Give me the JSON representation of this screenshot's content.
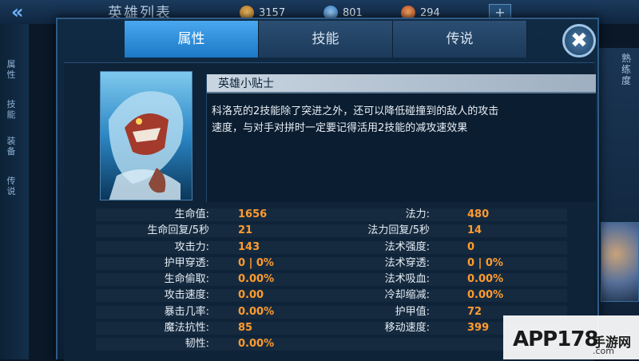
{
  "background": {
    "title": "英雄列表",
    "resources": [
      {
        "name": "gold-coin",
        "value": "3157"
      },
      {
        "name": "diamond",
        "value": "801"
      },
      {
        "name": "voucher",
        "value": "294"
      }
    ],
    "plus_label": "+",
    "rail_items": [
      "属性",
      "技能",
      "装备",
      "传说"
    ],
    "right_label": "熟练度"
  },
  "dialog": {
    "tabs": [
      {
        "label": "属性",
        "active": true
      },
      {
        "label": "技能",
        "active": false
      },
      {
        "label": "传说",
        "active": false
      }
    ],
    "close_label": "✖",
    "tips": {
      "title": "英雄小贴士",
      "line1": "科洛克的2技能除了突进之外，还可以降低碰撞到的敌人的攻击",
      "line2": "速度，与对手对拼时一定要记得活用2技能的减攻速效果"
    },
    "stats": [
      {
        "left_label": "生命值:",
        "left_value": "1656",
        "right_label": "法力:",
        "right_value": "480"
      },
      {
        "left_label": "生命回复/5秒",
        "left_value": "21",
        "right_label": "法力回复/5秒",
        "right_value": "14"
      },
      {
        "left_label": "攻击力:",
        "left_value": "143",
        "right_label": "法术强度:",
        "right_value": "0"
      },
      {
        "left_label": "护甲穿透:",
        "left_value": "0 | 0%",
        "right_label": "法术穿透:",
        "right_value": "0 | 0%"
      },
      {
        "left_label": "生命偷取:",
        "left_value": "0.00%",
        "right_label": "法术吸血:",
        "right_value": "0.00%"
      },
      {
        "left_label": "攻击速度:",
        "left_value": "0.00",
        "right_label": "冷却缩减:",
        "right_value": "0.00%"
      },
      {
        "left_label": "暴击几率:",
        "left_value": "0.00%",
        "right_label": "护甲值:",
        "right_value": "72"
      },
      {
        "left_label": "魔法抗性:",
        "left_value": "85",
        "right_label": "移动速度:",
        "right_value": "399"
      },
      {
        "left_label": "韧性:",
        "left_value": "0.00%",
        "right_label": "",
        "right_value": ""
      }
    ]
  },
  "watermark": {
    "brand": "APP178",
    "sub": "手游网",
    "domain": ".com"
  },
  "colors": {
    "accent": "#1b78c6",
    "value": "#ff9c2e",
    "panel": "#0e2338"
  }
}
